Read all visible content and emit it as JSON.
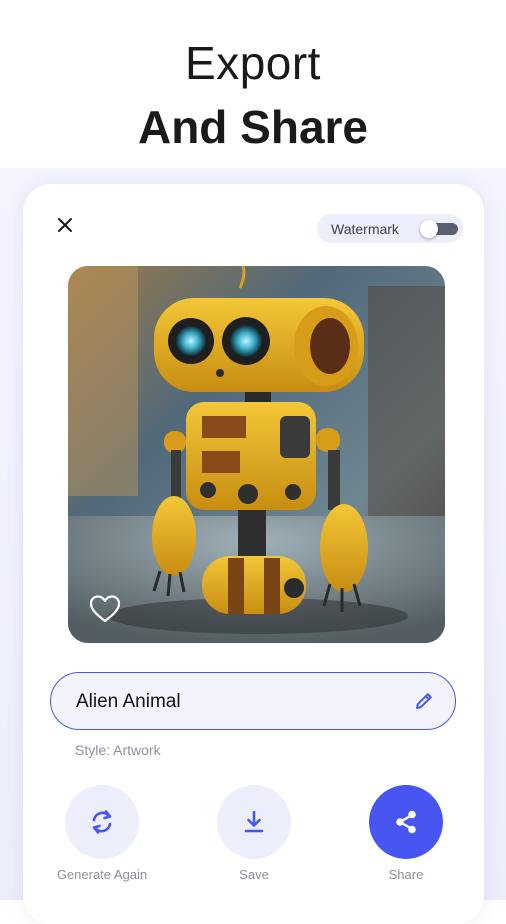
{
  "promo": {
    "line1": "Export",
    "line2": "And Share"
  },
  "toolbar": {
    "close_icon": "close-icon",
    "watermark_label": "Watermark",
    "watermark_enabled": false
  },
  "artwork": {
    "favorite_icon": "heart-outline-icon",
    "favorited": false
  },
  "prompt": {
    "title": "Alien Animal",
    "edit_icon": "pencil-icon",
    "style_text": "Style: Artwork"
  },
  "actions": [
    {
      "label": "Generate Again",
      "icon": "refresh-icon"
    },
    {
      "label": "Save",
      "icon": "download-icon"
    },
    {
      "label": "Share",
      "icon": "share-icon"
    }
  ],
  "colors": {
    "accent": "#4756f0",
    "pill_background": "#eceefb",
    "robot_yellow": "#e6b11f"
  }
}
